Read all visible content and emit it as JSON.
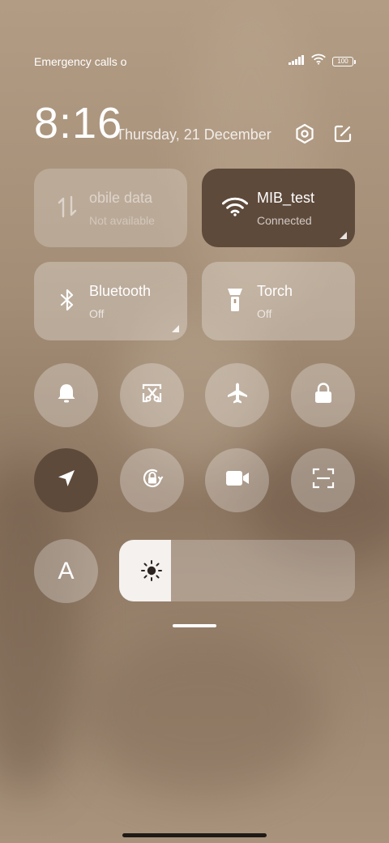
{
  "status_bar": {
    "carrier_text": "Emergency calls o",
    "battery_level": "100",
    "icons": [
      "signal-icon",
      "wifi-icon",
      "battery-icon"
    ]
  },
  "header": {
    "time": "8:16",
    "date": "Thursday, 21 December",
    "icons": [
      "settings-icon",
      "edit-icon"
    ]
  },
  "tiles": [
    {
      "label": "obile data",
      "status": "Not available",
      "icon": "mobile-data-icon",
      "state": "disabled"
    },
    {
      "label": "MIB_test",
      "status": "Connected",
      "icon": "wifi-icon",
      "state": "on"
    },
    {
      "label": "Bluetooth",
      "status": "Off",
      "icon": "bluetooth-icon",
      "state": "off"
    },
    {
      "label": "Torch",
      "status": "Off",
      "icon": "torch-icon",
      "state": "off"
    }
  ],
  "toggles": [
    {
      "icon": "bell-icon",
      "state": "off"
    },
    {
      "icon": "screenshot-icon",
      "state": "off"
    },
    {
      "icon": "airplane-icon",
      "state": "off"
    },
    {
      "icon": "lock-icon",
      "state": "off"
    },
    {
      "icon": "location-icon",
      "state": "on"
    },
    {
      "icon": "rotation-lock-icon",
      "state": "off"
    },
    {
      "icon": "video-camera-icon",
      "state": "off"
    },
    {
      "icon": "scanner-icon",
      "state": "off"
    },
    {
      "icon": "font-size-icon",
      "state": "off"
    }
  ],
  "font_button_label": "A",
  "brightness": {
    "icon": "sun-icon",
    "level": 0.22
  },
  "colors": {
    "accent_dark": "#5e4a3b",
    "tile_light": "rgba(255,255,255,0.28)"
  }
}
